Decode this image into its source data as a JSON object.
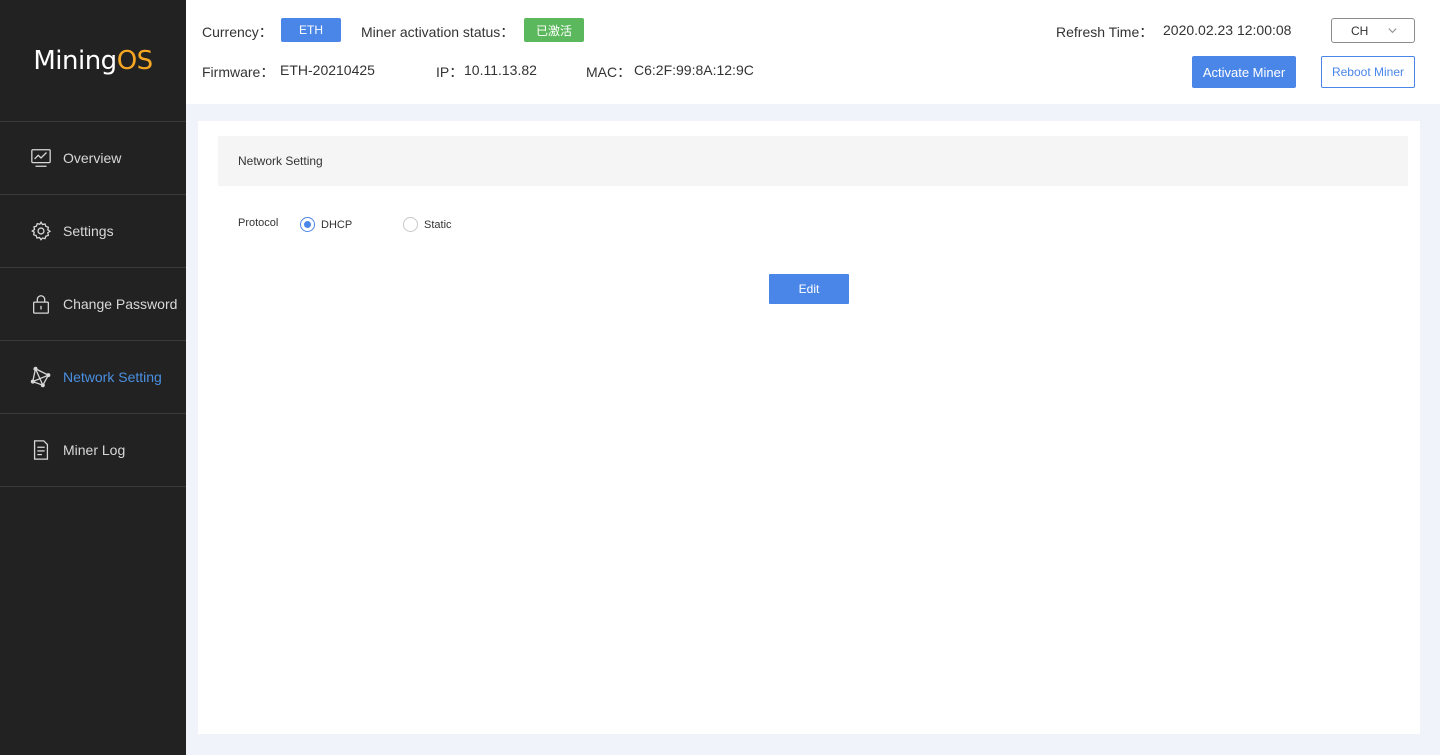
{
  "sidebar": {
    "logo_main": "Mining",
    "logo_accent": "OS",
    "items": [
      {
        "label": "Overview",
        "icon": "chart-monitor-icon",
        "active": false
      },
      {
        "label": "Settings",
        "icon": "gear-icon",
        "active": false
      },
      {
        "label": "Change Password",
        "icon": "lock-icon",
        "active": false
      },
      {
        "label": "Network Setting",
        "icon": "network-icon",
        "active": true
      },
      {
        "label": "Miner Log",
        "icon": "document-icon",
        "active": false
      }
    ]
  },
  "header": {
    "currency_label": "Currency：",
    "currency_value": "ETH",
    "activation_label": "Miner activation status：",
    "activation_value": "已激活",
    "refresh_label": "Refresh Time：",
    "refresh_value": "2020.02.23 12:00:08",
    "language_value": "CH",
    "firmware_label": "Firmware：",
    "firmware_value": "ETH-20210425",
    "ip_label": "IP：",
    "ip_value": "10.11.13.82",
    "mac_label": "MAC：",
    "mac_value": "C6:2F:99:8A:12:9C",
    "activate_btn": "Activate Miner",
    "reboot_btn": "Reboot Miner"
  },
  "main": {
    "section_title": "Network Setting",
    "protocol_label": "Protocol",
    "options": [
      {
        "label": "DHCP",
        "checked": true
      },
      {
        "label": "Static",
        "checked": false
      }
    ],
    "edit_btn": "Edit"
  },
  "colors": {
    "accent": "#4a86e8",
    "sidebar_bg": "#222222",
    "active_badge": "#5cb85c",
    "logo_accent": "#f5a623"
  }
}
